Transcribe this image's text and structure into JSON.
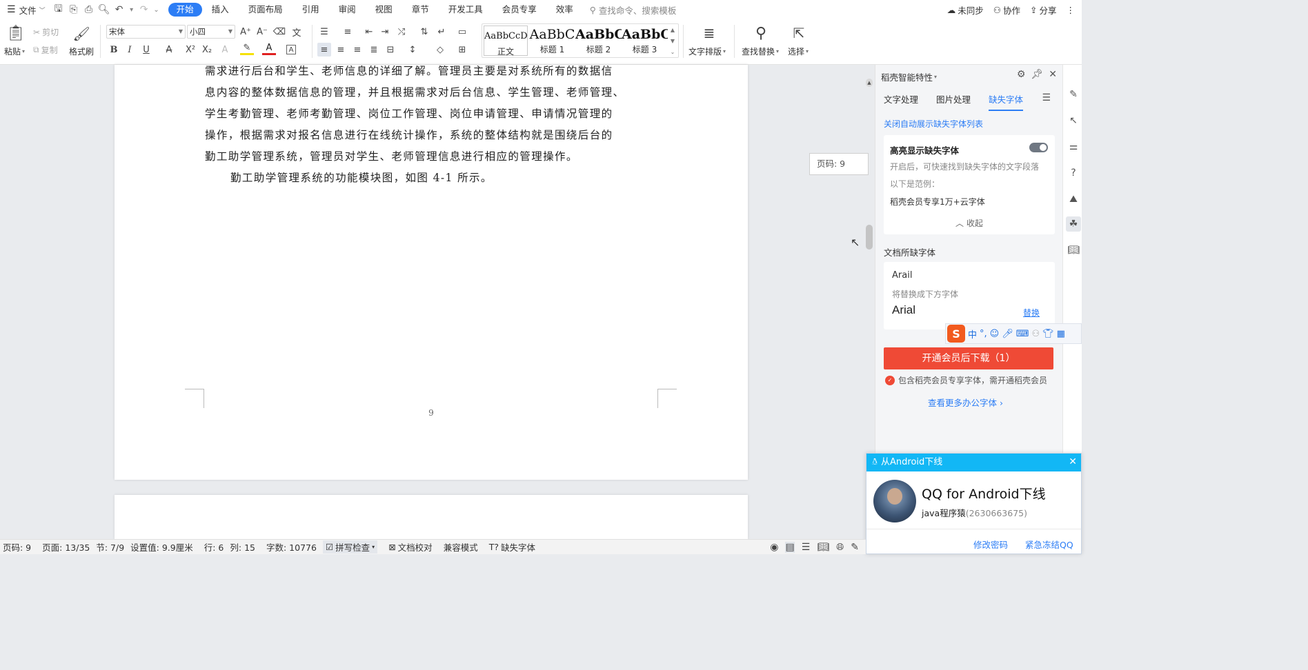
{
  "menubar": {
    "file_label": "文件",
    "tabs": [
      "开始",
      "插入",
      "页面布局",
      "引用",
      "审阅",
      "视图",
      "章节",
      "开发工具",
      "会员专享",
      "效率"
    ],
    "search_placeholder": "查找命令、搜索模板",
    "right": {
      "sync": "未同步",
      "collab": "协作",
      "share": "分享"
    }
  },
  "ribbon": {
    "paste": "粘贴",
    "cut": "剪切",
    "copy": "复制",
    "format_painter": "格式刷",
    "font_name": "宋体",
    "font_size": "小四",
    "styles": [
      {
        "sample": "AaBbCcDd",
        "name": "正文"
      },
      {
        "sample": "AaBbC",
        "name": "标题 1"
      },
      {
        "sample": "AaBbC",
        "name": "标题 2"
      },
      {
        "sample": "AaBbC",
        "name": "标题 3"
      }
    ],
    "text_layout": "文字排版",
    "find_replace": "查找替换",
    "select": "选择"
  },
  "document": {
    "lines": [
      "需求进行后台和学生、老师信息的详细了解。管理员主要是对系统所有的数据信",
      "息内容的整体数据信息的管理，并且根据需求对后台信息、学生管理、老师管理、",
      "学生考勤管理、老师考勤管理、岗位工作管理、岗位申请管理、申请情况管理的",
      "操作，根据需求对报名信息进行在线统计操作，系统的整体结构就是围绕后台的",
      "勤工助学管理系统，管理员对学生、老师管理信息进行相应的管理操作。",
      "勤工助学管理系统的功能模块图，如图 4-1 所示。"
    ],
    "page_number": "9",
    "page_tooltip": "页码: 9"
  },
  "panel": {
    "title": "稻壳智能特性",
    "tabs": [
      "文字处理",
      "图片处理",
      "缺失字体"
    ],
    "close_auto_link": "关闭自动展示缺失字体列表",
    "highlight": {
      "title": "高亮显示缺失字体",
      "desc": "开启后，可快速找到缺失字体的文字段落",
      "example_label": "以下是范例：",
      "example_text": "稻壳会员专享1万+云字体",
      "collapse": "收起"
    },
    "missing_section": "文档所缺字体",
    "missing": {
      "font": "Arail",
      "replace_hint": "将替换成下方字体",
      "replacement": "Arial",
      "replace_btn": "替换"
    },
    "download_btn": "开通会员后下载（1）",
    "note": "包含稻壳会员专享字体，需开通稻壳会员",
    "more_link": "查看更多办公字体"
  },
  "ime": {
    "mode": "中"
  },
  "qq_popup": {
    "header": "从Android下线",
    "title": "QQ for Android下线",
    "user": "java程序猿",
    "number": "(2630663675)",
    "link1": "修改密码",
    "link2": "紧急冻结QQ"
  },
  "status": {
    "page_no": "页码: 9",
    "page": "页面: 13/35",
    "section": "节: 7/9",
    "setting": "设置值: 9.9厘米",
    "row": "行: 6",
    "col": "列: 15",
    "words": "字数: 10776",
    "spell": "拼写检查",
    "proof": "文档校对",
    "compat": "兼容模式",
    "missing_font": "缺失字体"
  },
  "colors": {
    "accent": "#2c7df5",
    "download": "#ef4a36",
    "qq_header": "#12b7f5"
  }
}
